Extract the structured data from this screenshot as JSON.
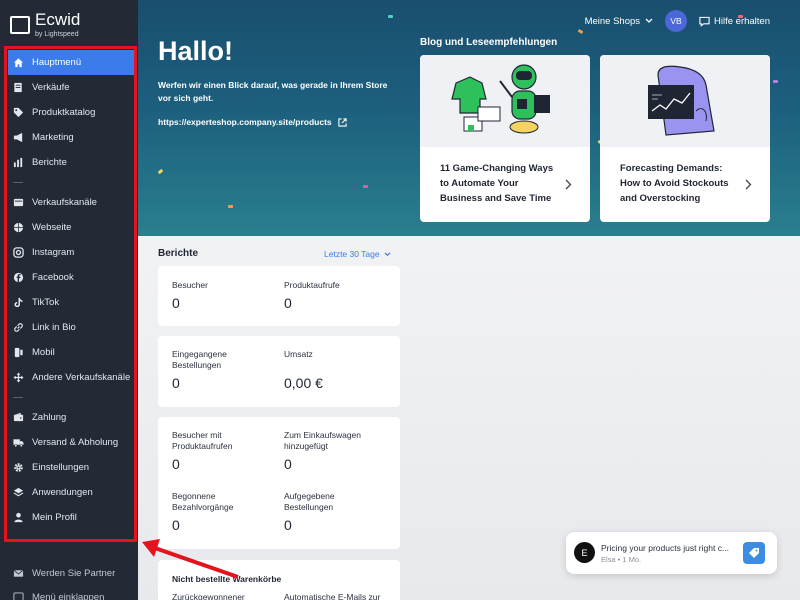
{
  "brand": {
    "name": "Ecwid",
    "sub": "by Lightspeed"
  },
  "sidebar": {
    "items": [
      {
        "label": "Hauptmenü",
        "icon": "home-icon",
        "active": true
      },
      {
        "label": "Verkäufe",
        "icon": "receipt-icon"
      },
      {
        "label": "Produktkatalog",
        "icon": "tag-icon"
      },
      {
        "label": "Marketing",
        "icon": "megaphone-icon"
      },
      {
        "label": "Berichte",
        "icon": "bar-chart-icon"
      },
      {
        "label": "Verkaufskanäle",
        "icon": "channels-icon"
      },
      {
        "label": "Webseite",
        "icon": "globe-icon"
      },
      {
        "label": "Instagram",
        "icon": "instagram-icon"
      },
      {
        "label": "Facebook",
        "icon": "facebook-icon"
      },
      {
        "label": "TikTok",
        "icon": "tiktok-icon"
      },
      {
        "label": "Link in Bio",
        "icon": "link-icon"
      },
      {
        "label": "Mobil",
        "icon": "mobile-icon"
      },
      {
        "label": "Andere Verkaufskanäle",
        "icon": "move-icon"
      },
      {
        "label": "Zahlung",
        "icon": "wallet-icon"
      },
      {
        "label": "Versand & Abholung",
        "icon": "truck-icon"
      },
      {
        "label": "Einstellungen",
        "icon": "gear-icon"
      },
      {
        "label": "Anwendungen",
        "icon": "layers-icon"
      },
      {
        "label": "Mein Profil",
        "icon": "user-icon"
      }
    ],
    "partner": "Werden Sie Partner",
    "collapse": "Menü einklappen"
  },
  "topbar": {
    "shops": "Meine Shops",
    "avatar": "VB",
    "help": "Hilfe erhalten"
  },
  "hero": {
    "title": "Hallo!",
    "subtitle": "Werfen wir einen Blick darauf, was gerade in Ihrem Store vor sich geht.",
    "link": "https://experteshop.company.site/products"
  },
  "blog": {
    "title": "Blog und Leseempfehlungen",
    "cards": [
      {
        "text": "11 Game-Changing Ways to Automate Your Business and Save Time"
      },
      {
        "text": "Forecasting Demands: How to Avoid Stockouts and Overstocking"
      }
    ]
  },
  "reports": {
    "title": "Berichte",
    "range": "Letzte 30 Tage",
    "card1": {
      "visitors_label": "Besucher",
      "visitors": "0",
      "views_label": "Produktaufrufe",
      "views": "0"
    },
    "card2": {
      "orders_label": "Eingegangene Bestellungen",
      "orders": "0",
      "revenue_label": "Umsatz",
      "revenue": "0,00 €"
    },
    "card3": {
      "pv_label": "Besucher mit Produktaufrufen",
      "pv": "0",
      "cart_label": "Zum Einkaufswagen hinzugefügt",
      "cart": "0",
      "checkout_label": "Begonnene Bezahlvorgänge",
      "checkout": "0",
      "abandoned_label": "Aufgegebene Bestellungen",
      "abandoned": "0"
    }
  },
  "carts": {
    "title": "Nicht bestellte Warenkörbe",
    "recovered": "Zurückgewonnener",
    "emails": "Automatische E-Mails zur"
  },
  "chat": {
    "avatar": "E",
    "message": "Pricing your products just right c...",
    "meta": "Elsa • 1 Mo."
  },
  "colors": {
    "sidebar": "#232a36",
    "accent": "#3b7bea",
    "highlight": "#e5131d"
  }
}
